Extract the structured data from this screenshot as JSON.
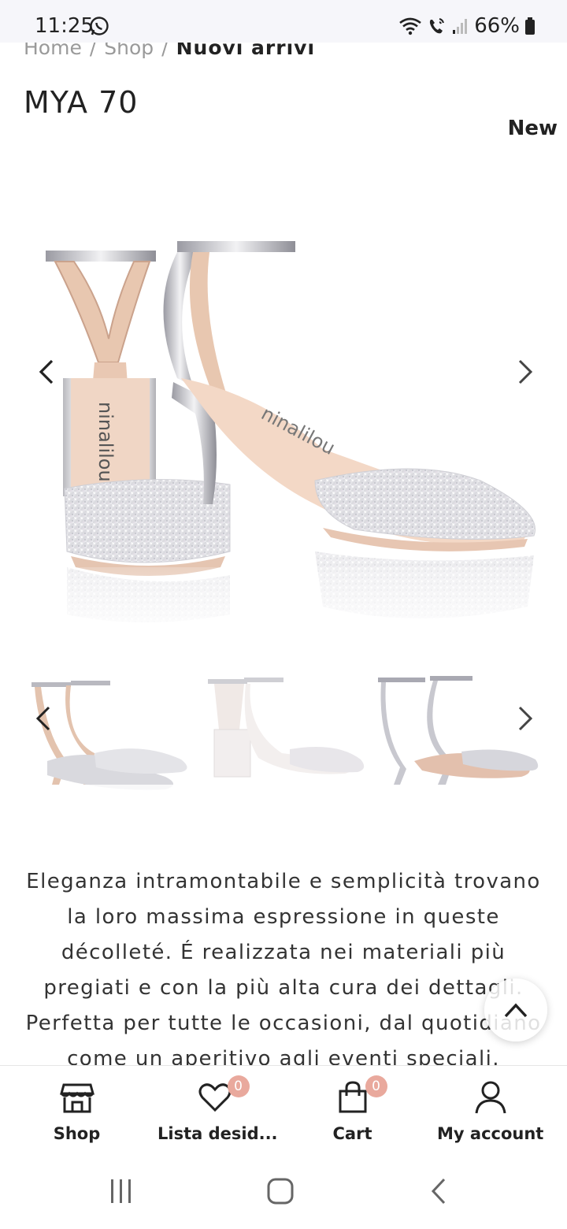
{
  "status_bar": {
    "time": "11:25",
    "battery": "66%"
  },
  "breadcrumb": {
    "items": [
      "Home",
      "Shop"
    ],
    "separator": "/",
    "current": "Nuovi arrivi"
  },
  "product": {
    "title": "MYA 70",
    "badge": "New",
    "main_image_brand": "ninalilou",
    "description": "Eleganza intramontabile e semplicità trovano la loro massima espressione in queste décolleté. É realizzata nei materiali più pregiati e con la più alta cura dei dettagli. Perfetta per tutte le occasioni, dal quotidiano come un aperitivo agli eventi speciali."
  },
  "thumbnails": [
    {
      "name": "silver-glitter-pair"
    },
    {
      "name": "white-glitter-pair"
    },
    {
      "name": "mirror-silver-pair"
    }
  ],
  "bottom_nav": {
    "items": [
      {
        "label": "Shop",
        "icon": "store-icon",
        "badge": ""
      },
      {
        "label": "Lista desid...",
        "icon": "heart-icon",
        "badge": "0"
      },
      {
        "label": "Cart",
        "icon": "bag-icon",
        "badge": "0"
      },
      {
        "label": "My account",
        "icon": "user-icon",
        "badge": ""
      }
    ]
  },
  "colors": {
    "badge": "#e9a99d",
    "text": "#222222",
    "muted": "#9a9a9a",
    "statusbar_bg": "#f6f6fa"
  }
}
